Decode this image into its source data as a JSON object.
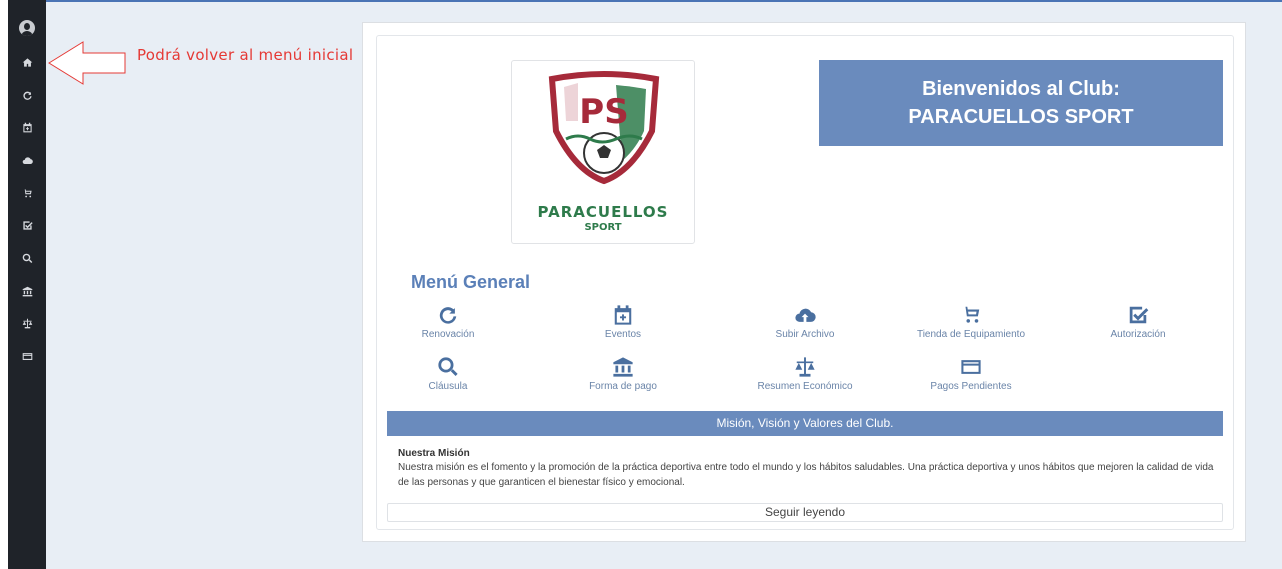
{
  "hint": {
    "text": "Podrá volver al menú inicial"
  },
  "sidebar": {
    "items": [
      {
        "icon": "home-icon"
      },
      {
        "icon": "refresh-icon"
      },
      {
        "icon": "calendar-plus-icon"
      },
      {
        "icon": "cloud-upload-icon"
      },
      {
        "icon": "cart-icon"
      },
      {
        "icon": "check-square-icon"
      },
      {
        "icon": "search-icon"
      },
      {
        "icon": "bank-icon"
      },
      {
        "icon": "balance-scale-icon"
      },
      {
        "icon": "credit-card-icon"
      }
    ]
  },
  "logo": {
    "line1": "PARACUELLOS",
    "line2": "SPORT",
    "monogram": "PS"
  },
  "welcome": {
    "line1": "Bienvenidos al Club:",
    "line2": "PARACUELLOS SPORT"
  },
  "menu": {
    "title": "Menú General",
    "items": [
      {
        "label": "Renovación",
        "icon": "refresh-icon"
      },
      {
        "label": "Eventos",
        "icon": "calendar-plus-icon"
      },
      {
        "label": "Subir Archivo",
        "icon": "cloud-upload-icon"
      },
      {
        "label": "Tienda de Equipamiento",
        "icon": "cart-icon"
      },
      {
        "label": "Autorización",
        "icon": "check-square-icon"
      },
      {
        "label": "Cláusula",
        "icon": "search-icon"
      },
      {
        "label": "Forma de pago",
        "icon": "bank-icon"
      },
      {
        "label": "Resumen Económico",
        "icon": "balance-scale-icon"
      },
      {
        "label": "Pagos Pendientes",
        "icon": "credit-card-icon"
      }
    ]
  },
  "mission": {
    "band": "Misión, Visión y Valores del Club.",
    "title": "Nuestra Misión",
    "text": "Nuestra misión es el fomento y la promoción de la práctica deportiva entre todo el mundo y los hábitos saludables. Una práctica deportiva y unos hábitos que mejoren la calidad de vida de las personas y que garanticen el bienestar físico y emocional.",
    "read_more": "Seguir leyendo"
  },
  "colors": {
    "accent": "#6a8bbd",
    "icon": "#4a6f9f",
    "sidebar": "#1f2329",
    "hint": "#e53935"
  }
}
